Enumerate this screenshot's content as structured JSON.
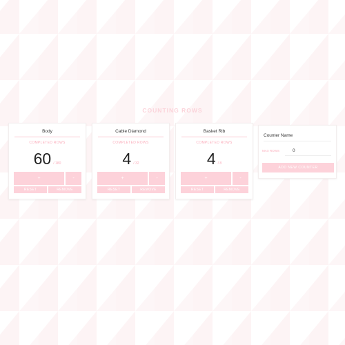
{
  "page": {
    "title": "COUNTING ROWS"
  },
  "counters": [
    {
      "name": "Body",
      "label": "COMPLETED ROWS",
      "count": "60",
      "total": "/ 180",
      "plus": "+",
      "minus": "-",
      "reset": "RESET",
      "remove": "REMOVE"
    },
    {
      "name": "Cable Diamond",
      "label": "COMPLETED ROWS",
      "count": "4",
      "total": "/ 32",
      "plus": "+",
      "minus": "-",
      "reset": "RESET",
      "remove": "REMOVE"
    },
    {
      "name": "Basket Rib",
      "label": "COMPLETED ROWS",
      "count": "4",
      "total": "/ 8",
      "plus": "+",
      "minus": "-",
      "reset": "RESET",
      "remove": "REMOVE"
    }
  ],
  "new_counter": {
    "name_placeholder": "Counter Name",
    "rows_label": "MAX ROWS",
    "rows_value": "0",
    "add_label": "ADD NEW COUNTER"
  },
  "colors": {
    "accent": "#fdd2da",
    "accent_text": "#fbaebc",
    "background_pattern": "#fdf3f4"
  }
}
